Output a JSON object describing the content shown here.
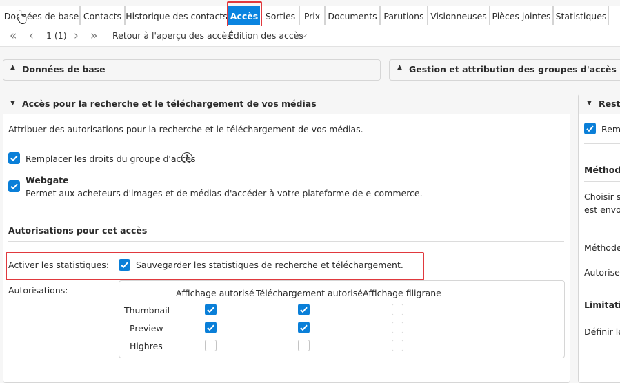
{
  "tabs": [
    {
      "label": "Données de base"
    },
    {
      "label": "Contacts"
    },
    {
      "label": "Historique des contacts"
    },
    {
      "label": "Accès",
      "active": true
    },
    {
      "label": "Sorties"
    },
    {
      "label": "Prix"
    },
    {
      "label": "Documents"
    },
    {
      "label": "Parutions"
    },
    {
      "label": "Visionneuses"
    },
    {
      "label": "Pièces jointes"
    },
    {
      "label": "Statistiques"
    }
  ],
  "toolbar": {
    "first_icon": "«",
    "prev_icon": "‹",
    "page": "1 (1)",
    "next_icon": "›",
    "last_icon": "»",
    "back_link": "Retour à l'aperçu des accès",
    "edit_menu": "Édition des accès",
    "edit_chevron": "⌵"
  },
  "sections": {
    "base_data": "Données de base",
    "groups": "Gestion et attribution des groupes d'accès",
    "access": "Accès pour la recherche et le téléchargement de vos médias",
    "right_title": "Restr"
  },
  "access": {
    "intro": "Attribuer des autorisations pour la recherche et le téléchargement de vos médias.",
    "replace_rights": "Remplacer les droits du groupe d'accès",
    "help_icon": "?",
    "webgate_title": "Webgate",
    "webgate_desc": "Permet aux acheteurs d'images et de médias d'accéder à votre plateforme de e-commerce.",
    "permissions_heading": "Autorisations pour cet accès",
    "stats_label": "Activer les statistiques:",
    "stats_checkbox": "Sauvegarder les statistiques de recherche et téléchargement.",
    "auth_label": "Autorisations:",
    "columns": [
      "Affichage autorisé",
      "Téléchargement autorisé",
      "Affichage filigrane"
    ],
    "rows": [
      {
        "name": "Thumbnail",
        "values": [
          true,
          true,
          false
        ]
      },
      {
        "name": "Preview",
        "values": [
          true,
          true,
          false
        ]
      },
      {
        "name": "Highres",
        "values": [
          false,
          false,
          false
        ]
      }
    ]
  },
  "right_panel": {
    "checkbox_label": "Rem",
    "methode1": "Méthode",
    "choisir_line1": "Choisir si",
    "choisir_line2": "est envoy",
    "methode2": "Méthode",
    "autoriser": "Autoriser",
    "limitation": "Limitation",
    "definir": "Définir le"
  },
  "colors": {
    "accent": "#0a84e0",
    "highlight": "#e0393e",
    "checkbox": "#0a7fd8"
  }
}
